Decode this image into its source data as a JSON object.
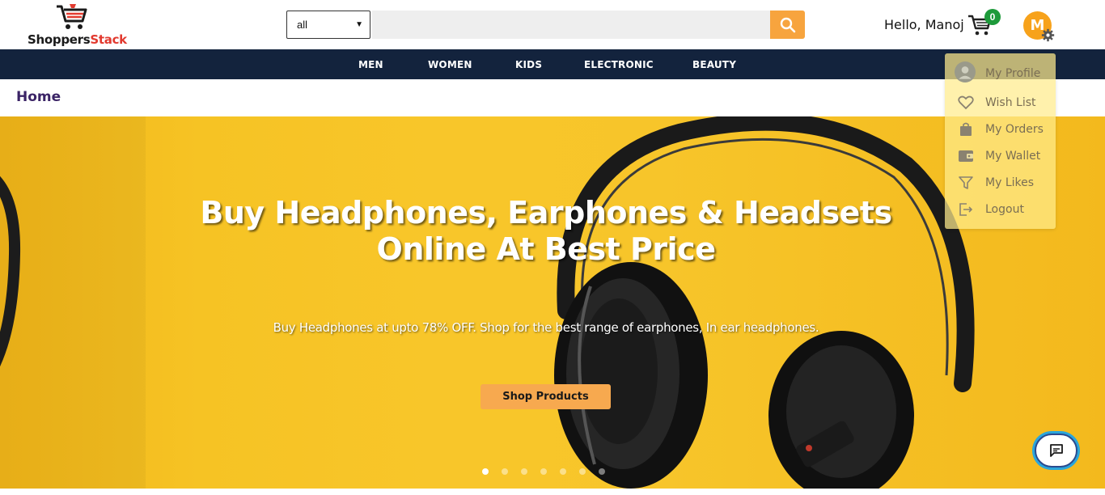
{
  "header": {
    "logo_part1": "Shoppers",
    "logo_part2": "Stack",
    "category_select": "all",
    "search_placeholder": "",
    "greeting": "Hello, Manoj",
    "cart_count": "0",
    "avatar_initial": "M"
  },
  "nav": {
    "items": [
      {
        "label": "MEN"
      },
      {
        "label": "WOMEN"
      },
      {
        "label": "KIDS"
      },
      {
        "label": "ELECTRONIC"
      },
      {
        "label": "BEAUTY"
      }
    ]
  },
  "breadcrumb": "Home",
  "hero": {
    "title_line1": "Buy Headphones, Earphones & Headsets",
    "title_line2": "Online At Best Price",
    "subtitle": "Buy Headphones at upto 78% OFF. Shop for the best range of earphones, In ear headphones.",
    "button": "Shop Products",
    "slide_count": 7,
    "active_slide": 1
  },
  "profile_menu": {
    "items": [
      {
        "label": "My Profile",
        "icon": "user-icon"
      },
      {
        "label": "Wish List",
        "icon": "heart-icon"
      },
      {
        "label": "My Orders",
        "icon": "bag-icon"
      },
      {
        "label": "My Wallet",
        "icon": "wallet-icon"
      },
      {
        "label": "My Likes",
        "icon": "filter-icon"
      },
      {
        "label": "Logout",
        "icon": "logout-icon"
      }
    ]
  },
  "colors": {
    "accent": "#f7a43e",
    "nav_bg": "#13233d",
    "cart_badge": "#1d9a3a",
    "avatar": "#f7a21b",
    "brand_red": "#e23a2f"
  }
}
